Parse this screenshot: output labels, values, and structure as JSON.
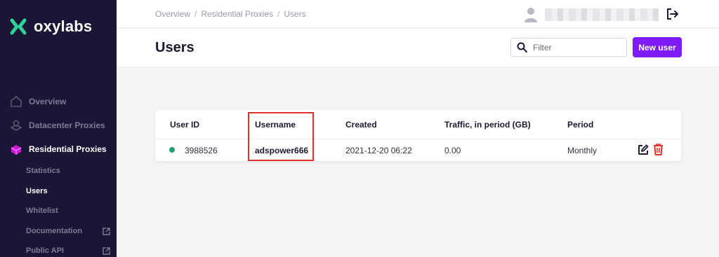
{
  "brand": {
    "name": "oxylabs"
  },
  "sidebar": {
    "items": [
      {
        "label": "Overview",
        "icon": "home-icon"
      },
      {
        "label": "Datacenter Proxies",
        "icon": "datacenter-icon"
      },
      {
        "label": "Residential Proxies",
        "icon": "residential-icon"
      }
    ],
    "subitems": [
      {
        "label": "Statistics"
      },
      {
        "label": "Users"
      },
      {
        "label": "Whitelist"
      },
      {
        "label": "Documentation"
      },
      {
        "label": "Public API"
      }
    ]
  },
  "breadcrumb": [
    "Overview",
    "Residential Proxies",
    "Users"
  ],
  "breadcrumb_sep": "/",
  "header": {
    "title": "Users",
    "filter_placeholder": "Filter",
    "new_user_label": "New user"
  },
  "table": {
    "columns": [
      "User ID",
      "Username",
      "Created",
      "Traffic, in period (GB)",
      "Period"
    ],
    "rows": [
      {
        "user_id": "3988526",
        "username": "adspower666",
        "created": "2021-12-20 06:22",
        "traffic": "0.00",
        "period": "Monthly",
        "status": "active"
      }
    ]
  },
  "colors": {
    "accent": "#7d1cf4",
    "sidebar_bg": "#1d1535",
    "logo_green": "#2fd39a",
    "status_green": "#19a36b",
    "delete_red": "#e0312b",
    "highlight": "#e0312b"
  }
}
